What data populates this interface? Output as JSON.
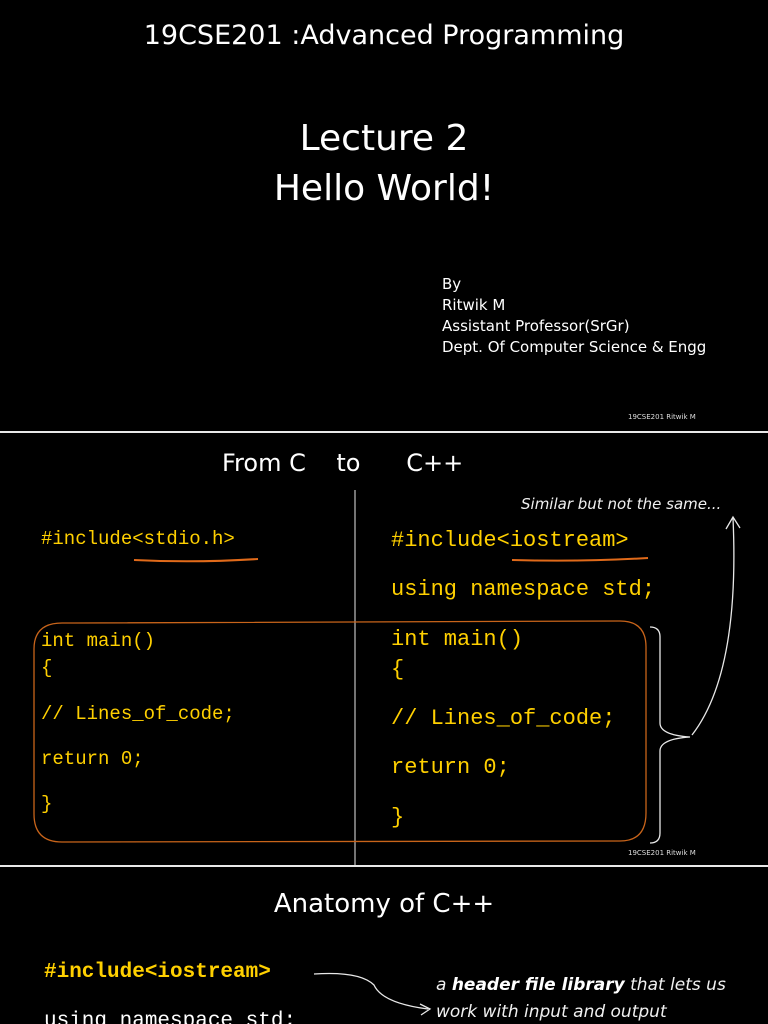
{
  "slide1": {
    "course_title": "19CSE201 :Advanced Programming",
    "lecture": "Lecture 2",
    "topic": "Hello World!",
    "author_lines": [
      "By",
      "Ritwik M",
      "Assistant Professor(SrGr)",
      "Dept. Of Computer Science & Engg"
    ],
    "footer": "19CSE201 Ritwik M"
  },
  "slide2": {
    "title": "From C    to      C++",
    "annotation": "Similar but not the same...",
    "c_code": {
      "include": "#include<stdio.h>",
      "main": "int main()",
      "open": "{",
      "comment": "// Lines_of_code;",
      "ret": "return 0;",
      "close": "}"
    },
    "cpp_code": {
      "include": "#include<iostream>",
      "ns": "using namespace std;",
      "main": "int main()",
      "open": "{",
      "comment": "// Lines_of_code;",
      "ret": "return 0;",
      "close": "}"
    },
    "footer": "19CSE201 Ritwik M"
  },
  "slide3": {
    "title": "Anatomy of C++",
    "include": "#include<iostream>",
    "ns": "using namespace std;",
    "note_a": "a",
    "note_bold": "header file library",
    "note_rest": "that lets us",
    "note_line2": "work with input and output"
  },
  "colors": {
    "code": "#ffd000",
    "underline": "#e06a1a",
    "box": "#c8641a"
  }
}
